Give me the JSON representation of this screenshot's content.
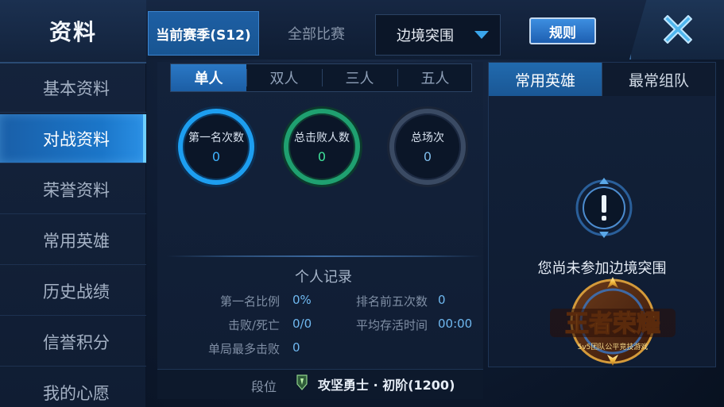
{
  "sidebar": {
    "title": "资料",
    "items": [
      {
        "label": "基本资料",
        "active": false
      },
      {
        "label": "对战资料",
        "active": true
      },
      {
        "label": "荣誉资料",
        "active": false
      },
      {
        "label": "常用英雄",
        "active": false
      },
      {
        "label": "历史战绩",
        "active": false
      },
      {
        "label": "信誉积分",
        "active": false
      },
      {
        "label": "我的心愿",
        "active": false
      }
    ]
  },
  "topbar": {
    "season_tab": "当前赛季(S12)",
    "all_tab": "全部比赛",
    "mode_select": {
      "value": "边境突围",
      "icon": "chevron-down-icon"
    },
    "rules_button": "规则",
    "close_icon": "close-icon"
  },
  "sub_tabs": [
    {
      "label": "单人",
      "active": true
    },
    {
      "label": "双人",
      "active": false
    },
    {
      "label": "三人",
      "active": false
    },
    {
      "label": "五人",
      "active": false
    }
  ],
  "stats": [
    {
      "label": "第一名次数",
      "value": "0",
      "color": "#1d9ef0"
    },
    {
      "label": "总击败人数",
      "value": "0",
      "color": "#1fa070"
    },
    {
      "label": "总场次",
      "value": "0",
      "color": "#3a4a63"
    }
  ],
  "record": {
    "title": "个人记录",
    "first_rate": {
      "label": "第一名比例",
      "value": "0%"
    },
    "top5_count": {
      "label": "排名前五次数",
      "value": "0"
    },
    "kd": {
      "label": "击败/死亡",
      "value": "0/0"
    },
    "avg_survival": {
      "label": "平均存活时间",
      "value": "00:00"
    },
    "max_kills": {
      "label": "单局最多击败",
      "value": "0"
    }
  },
  "rank": {
    "label": "段位",
    "value": "攻坚勇士 · 初阶(1200)",
    "icon": "rank-badge-icon"
  },
  "right_panel": {
    "tabs": [
      {
        "label": "常用英雄",
        "active": true
      },
      {
        "label": "最常组队",
        "active": false
      }
    ],
    "empty_message": "您尚未参加边境突围",
    "alert_icon": "alert-icon",
    "logo": {
      "text": "王者荣耀",
      "tagline": "5v5团队公平竞技游戏"
    }
  },
  "colors": {
    "accent_blue": "#1d9ef0",
    "accent_green": "#1fa070",
    "active_tab": "#1c5ea5",
    "value_text": "#6fb8f0"
  }
}
